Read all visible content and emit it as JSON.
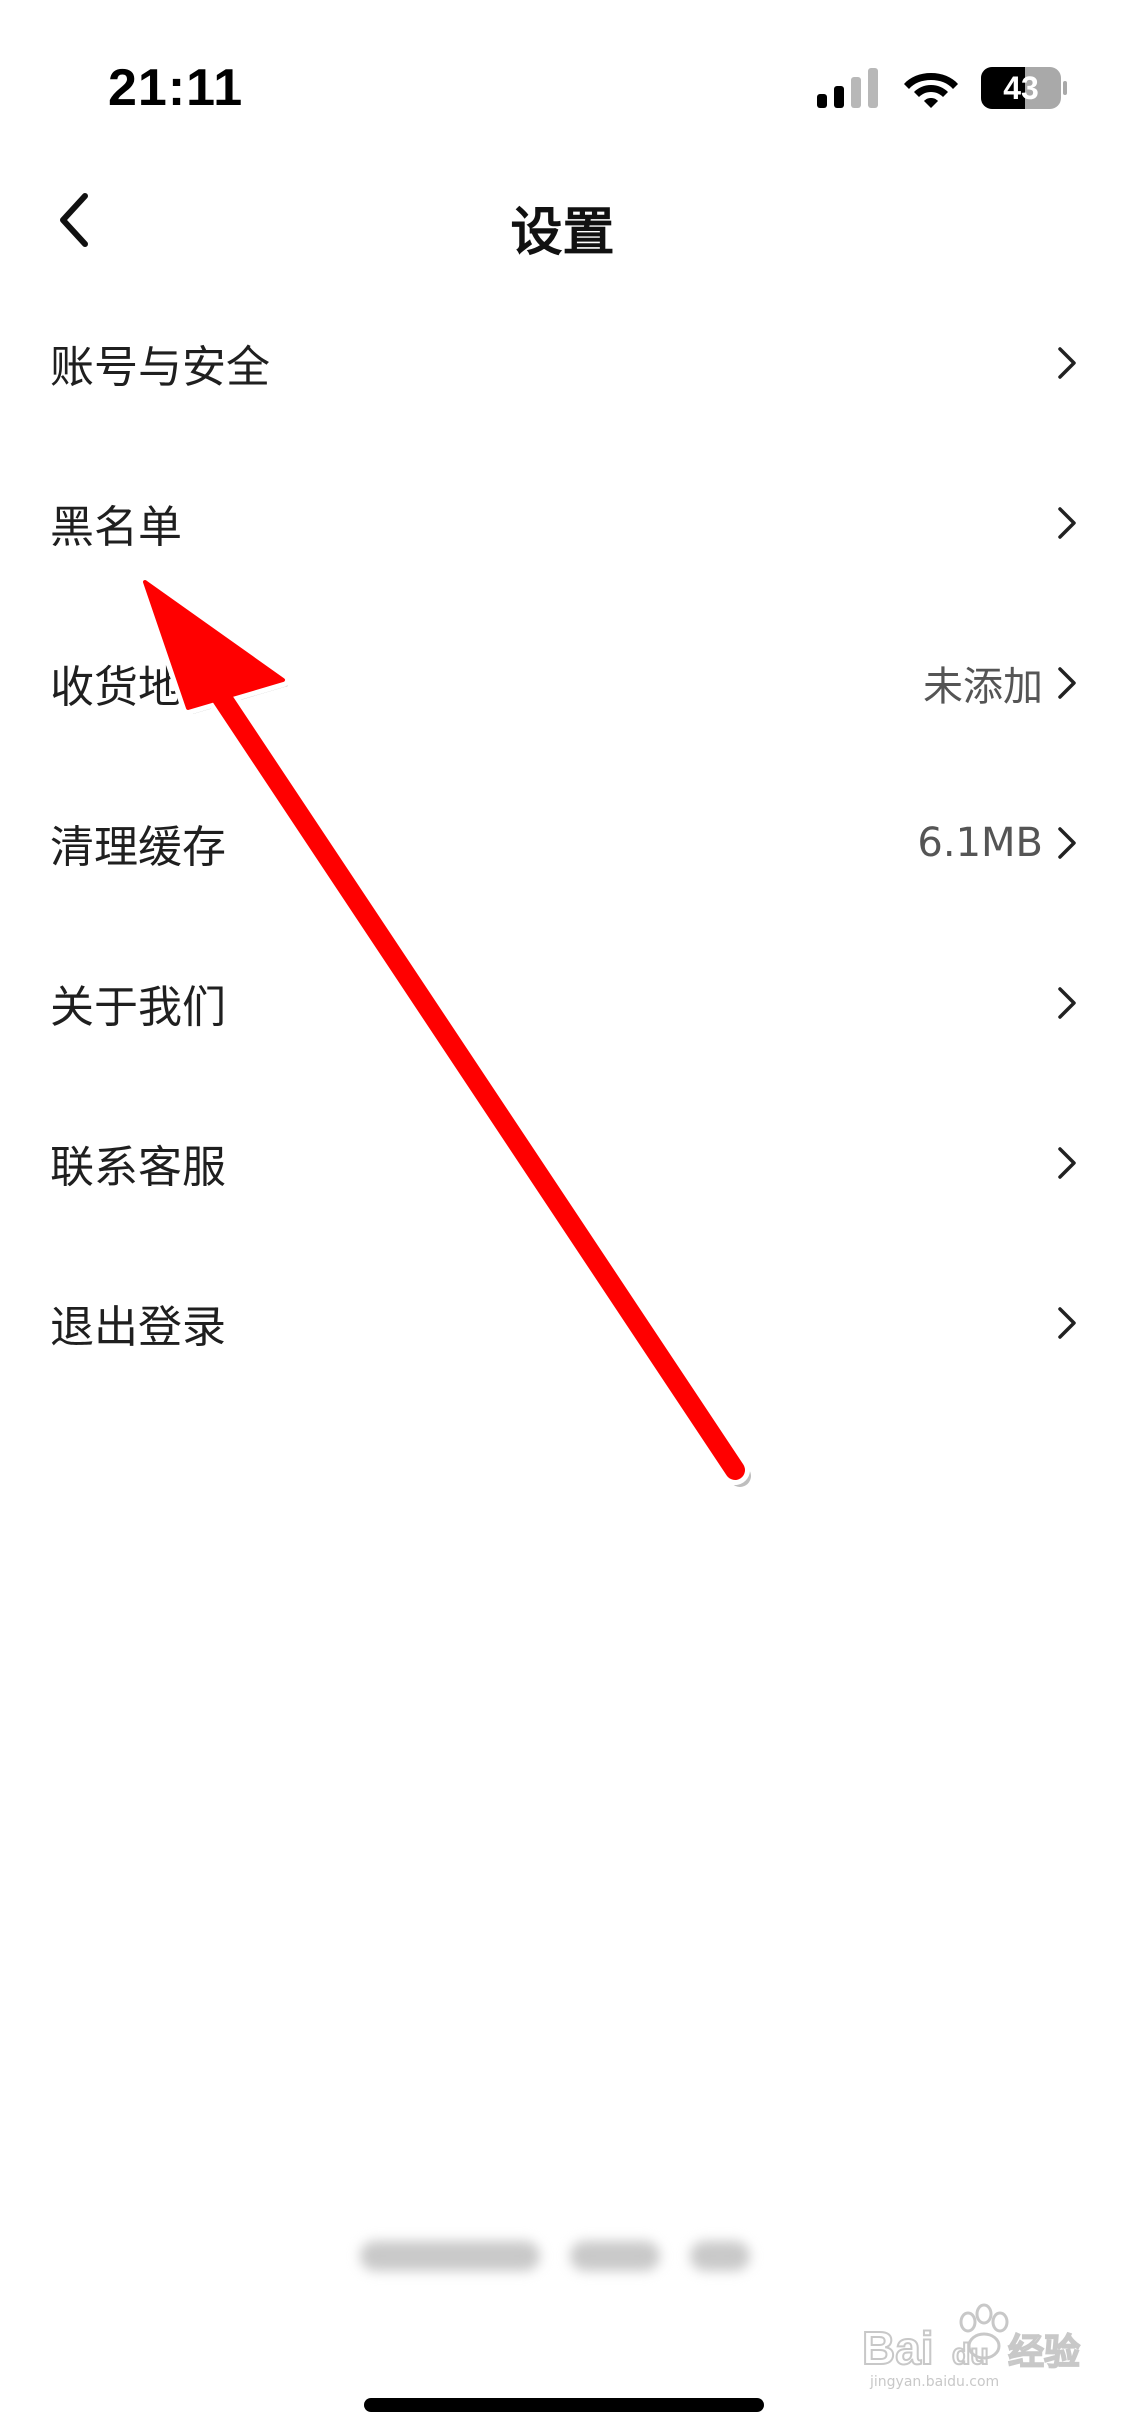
{
  "status_bar": {
    "time": "21:11",
    "battery": "43",
    "icons": [
      "signal-icon",
      "wifi-icon",
      "battery-icon"
    ]
  },
  "nav": {
    "title": "设置",
    "back_icon": "chevron-left-icon"
  },
  "settings": {
    "items": [
      {
        "label": "账号与安全",
        "value": ""
      },
      {
        "label": "黑名单",
        "value": ""
      },
      {
        "label": "收货地",
        "value": "未添加"
      },
      {
        "label": "清理缓存",
        "value": "6.1MB"
      },
      {
        "label": "关于我们",
        "value": ""
      },
      {
        "label": "联系客服",
        "value": ""
      },
      {
        "label": "退出登录",
        "value": ""
      }
    ]
  },
  "colors": {
    "annotation_arrow": "#ff0000",
    "background": "#ffffff",
    "text_primary": "#1f1f1f",
    "text_secondary": "#555555"
  },
  "watermark": {
    "brand": "Bai",
    "brand_suffix": "du",
    "product": "经验",
    "url": "jingyan.baidu.com"
  }
}
